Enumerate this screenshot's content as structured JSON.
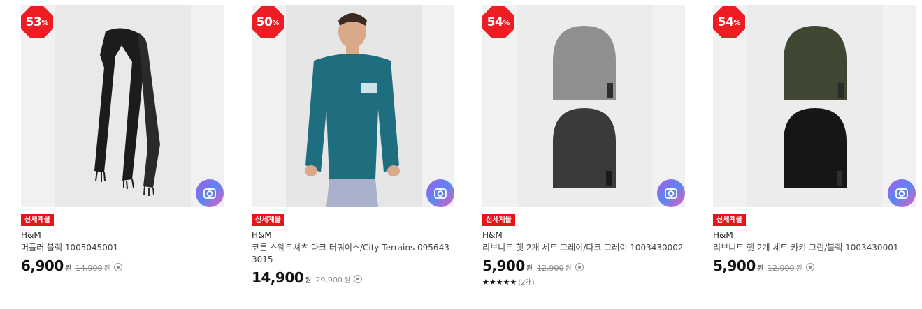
{
  "products": [
    {
      "discount": "53",
      "discount_unit": "%",
      "tag": "신세계몰",
      "brand": "H&M",
      "title": "머플러 블랙 1005045001",
      "price": "6,900",
      "price_unit": "원",
      "original_price": "14,900",
      "original_unit": "원",
      "image_icon": "scarf-image"
    },
    {
      "discount": "50",
      "discount_unit": "%",
      "tag": "신세계몰",
      "brand": "H&M",
      "title": "코튼 스웨트셔츠 다크 터쿼이스/City Terrains 0956433015",
      "price": "14,900",
      "price_unit": "원",
      "original_price": "29,900",
      "original_unit": "원",
      "image_icon": "sweatshirt-model-image"
    },
    {
      "discount": "54",
      "discount_unit": "%",
      "tag": "신세계몰",
      "brand": "H&M",
      "title": "리브니트 햇 2개 세트 그레이/다크 그레이 1003430002",
      "price": "5,900",
      "price_unit": "원",
      "original_price": "12,900",
      "original_unit": "원",
      "rating_stars": "★★★★★",
      "rating_count": "(2개)",
      "image_icon": "beanie-grey-image"
    },
    {
      "discount": "54",
      "discount_unit": "%",
      "tag": "신세계몰",
      "brand": "H&M",
      "title": "리브니트 햇 2개 세트 카키 그린/블랙 1003430001",
      "price": "5,900",
      "price_unit": "원",
      "original_price": "12,900",
      "original_unit": "원",
      "image_icon": "beanie-khaki-image"
    }
  ],
  "colors": {
    "badge": "#ee1d23",
    "tag": "#e8141b"
  }
}
